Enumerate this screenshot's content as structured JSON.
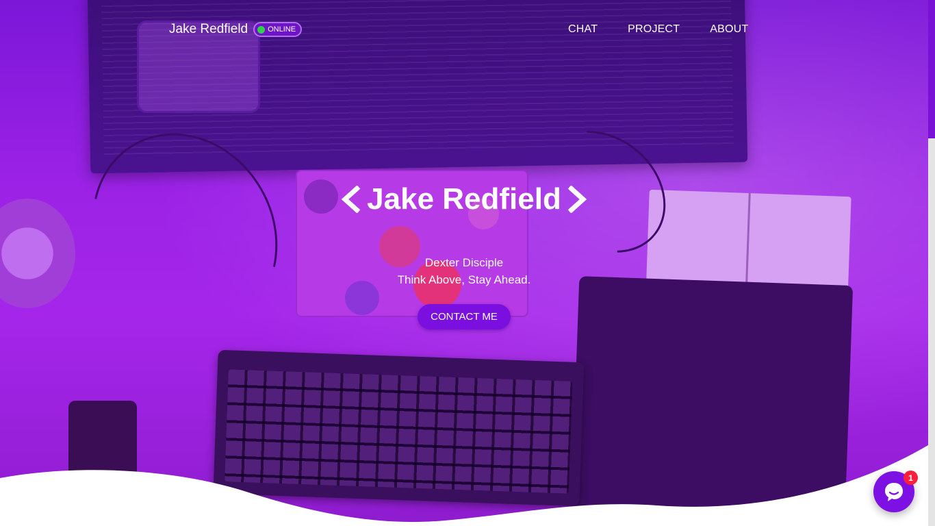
{
  "header": {
    "brand": "Jake Redfield",
    "status": "ONLINE",
    "nav": [
      "CHAT",
      "PROJECT",
      "ABOUT"
    ]
  },
  "hero": {
    "title": "Jake Redfield",
    "subtitle_line1": "Dexter Disciple",
    "subtitle_line2": "Think Above, Stay Ahead.",
    "cta": "CONTACT ME"
  },
  "chat_widget": {
    "badge_count": "1",
    "icon": "chat-bubble-icon"
  },
  "colors": {
    "accent": "#7a0fe0",
    "overlay": "#9b22e6",
    "status_online": "#2fd14a",
    "badge": "#ff1f3d"
  }
}
